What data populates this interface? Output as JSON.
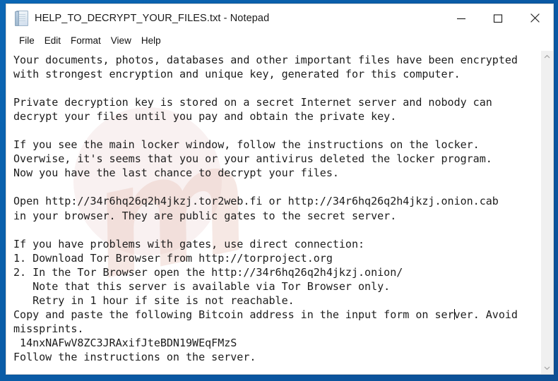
{
  "window": {
    "icon": "notepad-icon",
    "title": "HELP_TO_DECRYPT_YOUR_FILES.txt - Notepad",
    "controls": {
      "minimize": "minimize-button",
      "maximize": "maximize-button",
      "close": "close-button"
    }
  },
  "menubar": {
    "items": [
      {
        "label": "File"
      },
      {
        "label": "Edit"
      },
      {
        "label": "Format"
      },
      {
        "label": "View"
      },
      {
        "label": "Help"
      }
    ]
  },
  "editor": {
    "text_before_caret": "Your documents, photos, databases and other important files have been encrypted\nwith strongest encryption and unique key, generated for this computer.\n\nPrivate decryption key is stored on a secret Internet server and nobody can\ndecrypt your files until you pay and obtain the private key.\n\nIf you see the main locker window, follow the instructions on the locker.\nOverwise, it's seems that you or your antivirus deleted the locker program.\nNow you have the last chance to decrypt your files.\n\nOpen http://34r6hq26q2h4jkzj.tor2web.fi or http://34r6hq26q2h4jkzj.onion.cab\nin your browser. They are public gates to the secret server.\n\nIf you have problems with gates, use direct connection:\n1. Download Tor Browser from http://torproject.org\n2. In the Tor Browser open the http://34r6hq26q2h4jkzj.onion/\n   Note that this server is available via Tor Browser only.\n   Retry in 1 hour if site is not reachable.\nCopy and paste the following Bitcoin address in the input form on ser",
    "text_after_caret": "ver. Avoid\nmissprints.\n 14nxNAFwV8ZC3JRAxifJteBDN19WEqFMzS\nFollow the instructions on the server.",
    "bitcoin_address": "14nxNAFwV8ZC3JRAxifJteBDN19WEqFMzS",
    "urls": [
      "http://34r6hq26q2h4jkzj.tor2web.fi",
      "http://34r6hq26q2h4jkzj.onion.cab",
      "http://torproject.org",
      "http://34r6hq26q2h4jkzj.onion/"
    ],
    "watermark": "m"
  },
  "scrollbar": {
    "up_arrow": "scroll-up-arrow",
    "down_arrow": "scroll-down-arrow"
  },
  "colors": {
    "desktop": "#0a5ca8",
    "window_bg": "#ffffff",
    "text": "#1d1d1d",
    "scrollbar_track": "#f0f0f0"
  }
}
